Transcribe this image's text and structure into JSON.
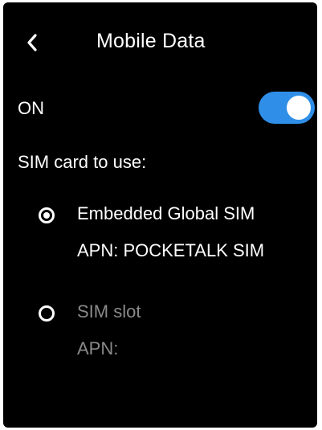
{
  "header": {
    "title": "Mobile Data",
    "back_icon": "chevron-left-icon"
  },
  "mobile_data": {
    "label": "ON",
    "enabled": true,
    "accent_color": "#2f8fe8"
  },
  "sim_selection": {
    "heading": "SIM card to use:",
    "options": [
      {
        "name": "Embedded Global SIM",
        "apn": "APN: POCKETALK SIM",
        "selected": true
      },
      {
        "name": "SIM slot",
        "apn": "APN:",
        "selected": false
      }
    ]
  }
}
